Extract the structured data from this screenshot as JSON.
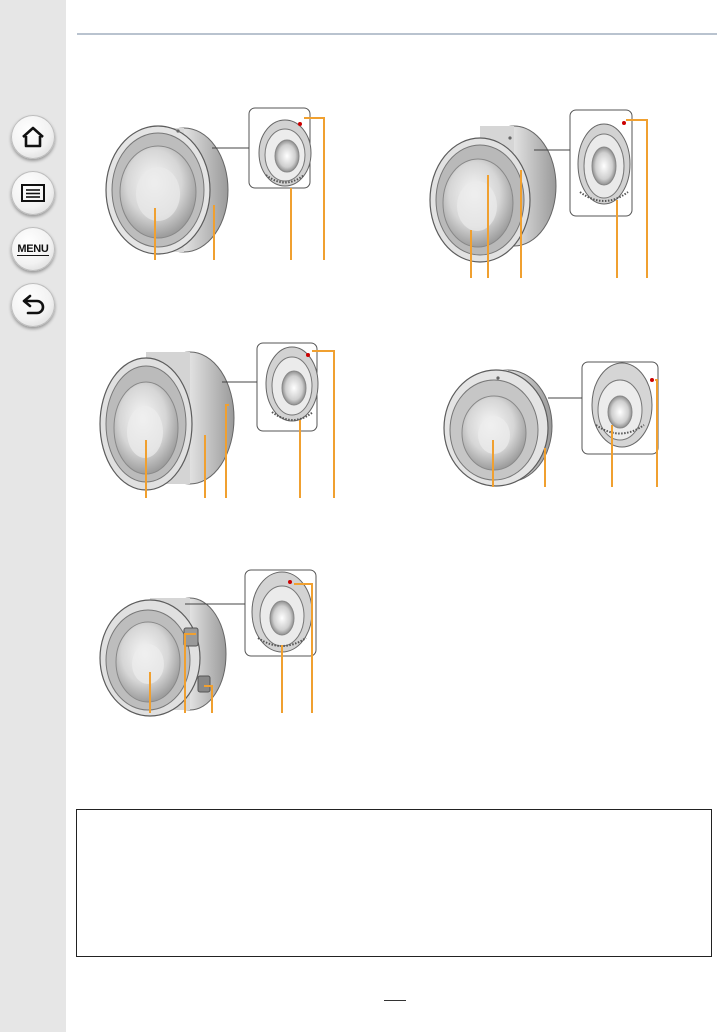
{
  "sidebar": {
    "buttons": [
      {
        "name": "home-button",
        "icon": "home-icon"
      },
      {
        "name": "contents-button",
        "icon": "list-icon"
      },
      {
        "name": "menu-button",
        "icon": "menu-icon",
        "label": "MENU"
      },
      {
        "name": "back-button",
        "icon": "back-arrow-icon"
      }
    ]
  },
  "colors": {
    "accent": "#f0a030",
    "sidebar": "#e6e6e6",
    "rule": "#b9c3cf"
  },
  "lenses": [
    {
      "id": "lens-1",
      "callouts": 4
    },
    {
      "id": "lens-2",
      "callouts": 5
    },
    {
      "id": "lens-3",
      "callouts": 5
    },
    {
      "id": "lens-4",
      "callouts": 4
    },
    {
      "id": "lens-5",
      "callouts": 5
    }
  ]
}
